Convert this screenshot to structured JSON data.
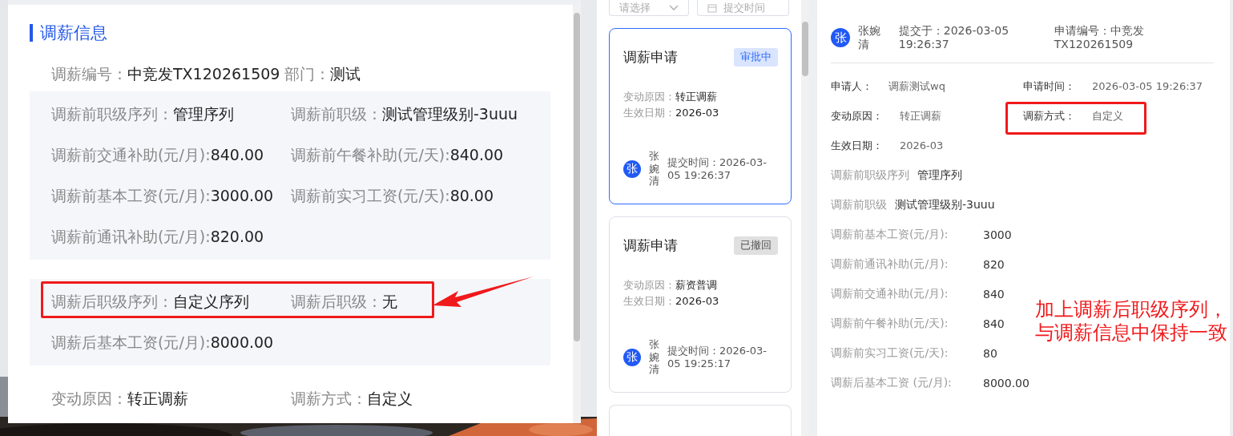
{
  "salary_info": {
    "title": "调薪信息",
    "header_fields": [
      {
        "label": "调薪编号：",
        "value": "中竞发TX120261509"
      },
      {
        "label": "部门：",
        "value": "测试"
      }
    ],
    "sections": [
      {
        "rows": [
          {
            "highlighted": false,
            "fields": [
              {
                "label": "调薪前职级序列：",
                "value": "管理序列"
              },
              {
                "label": "调薪前职级：",
                "value": "测试管理级别-3uuu"
              }
            ]
          },
          {
            "highlighted": false,
            "fields": [
              {
                "label": "调薪前交通补助(元/月):",
                "value": "840.00"
              },
              {
                "label": "调薪前午餐补助(元/天):",
                "value": "840.00"
              }
            ]
          },
          {
            "highlighted": false,
            "fields": [
              {
                "label": "调薪前基本工资(元/月):",
                "value": "3000.00"
              },
              {
                "label": "调薪前实习工资(元/天):",
                "value": "80.00"
              }
            ]
          },
          {
            "highlighted": false,
            "fields": [
              {
                "label": "调薪前通讯补助(元/月):",
                "value": "820.00"
              }
            ]
          }
        ]
      },
      {
        "rows": [
          {
            "highlighted": true,
            "fields": [
              {
                "label": "调薪后职级序列：",
                "value": "自定义序列"
              },
              {
                "label": "调薪后职级：",
                "value": "无"
              }
            ]
          },
          {
            "highlighted": false,
            "fields": [
              {
                "label": "调薪后基本工资(元/月):",
                "value": "8000.00"
              }
            ]
          }
        ]
      }
    ],
    "footer_fields": [
      {
        "label": "变动原因：",
        "value": "转正调薪"
      },
      {
        "label": "调薪方式：",
        "value": "自定义"
      }
    ]
  },
  "filters": [
    {
      "kind": "select",
      "placeholder": "请选择"
    },
    {
      "kind": "date",
      "placeholder": "提交时间"
    }
  ],
  "request_cards": [
    {
      "title": "调薪申请",
      "status": "审批中",
      "color": "#2f6bff",
      "selected": true,
      "fields": [
        {
          "label": "变动原因：",
          "value": "转正调薪"
        },
        {
          "label": "生效日期：",
          "value": "2026-03"
        }
      ],
      "avatar": "张",
      "name": "张婉清",
      "submit_time": "提交时间：2026-03-05 19:26:37"
    },
    {
      "title": "调薪申请",
      "status": "已撤回",
      "color": "#555555",
      "selected": false,
      "fields": [
        {
          "label": "变动原因：",
          "value": "薪资普调"
        },
        {
          "label": "生效日期：",
          "value": "2026-03"
        }
      ],
      "avatar": "张",
      "name": "张婉清",
      "submit_time": "提交时间：2026-03-05 19:25:17"
    }
  ],
  "detail": {
    "avatar": "张",
    "name": "张婉清",
    "submitted": "提交于：2026-03-05 19:26:37",
    "request_no": "申请编号：中竞发TX120261509",
    "info_fields": [
      {
        "label": "申请人：",
        "value": "调薪测试wq",
        "highlighted": false
      },
      {
        "label": "申请时间：",
        "value": "2026-03-05 19:26:37",
        "highlighted": false
      },
      {
        "label": "变动原因：",
        "value": "转正调薪",
        "highlighted": false
      },
      {
        "label": "调薪方式：",
        "value": "自定义",
        "highlighted": true
      },
      {
        "label": "生效日期：",
        "value": "2026-03",
        "highlighted": false
      }
    ],
    "salary_fields": [
      {
        "label": "调薪前职级序列",
        "value": "管理序列"
      },
      {
        "label": "调薪前职级",
        "value": "测试管理级别-3uuu"
      },
      {
        "label": "调薪前基本工资(元/月):",
        "value": "3000"
      },
      {
        "label": "调薪前通讯补助(元/月):",
        "value": "820"
      },
      {
        "label": "调薪前交通补助(元/月):",
        "value": "840"
      },
      {
        "label": "调薪前午餐补助(元/天):",
        "value": "840"
      },
      {
        "label": "调薪前实习工资(元/天):",
        "value": "80"
      },
      {
        "label": "调薪后基本工资 (元/月):",
        "value": "8000.00"
      }
    ]
  },
  "note": "加上调薪后职级序列，与调薪信息中保持一致"
}
